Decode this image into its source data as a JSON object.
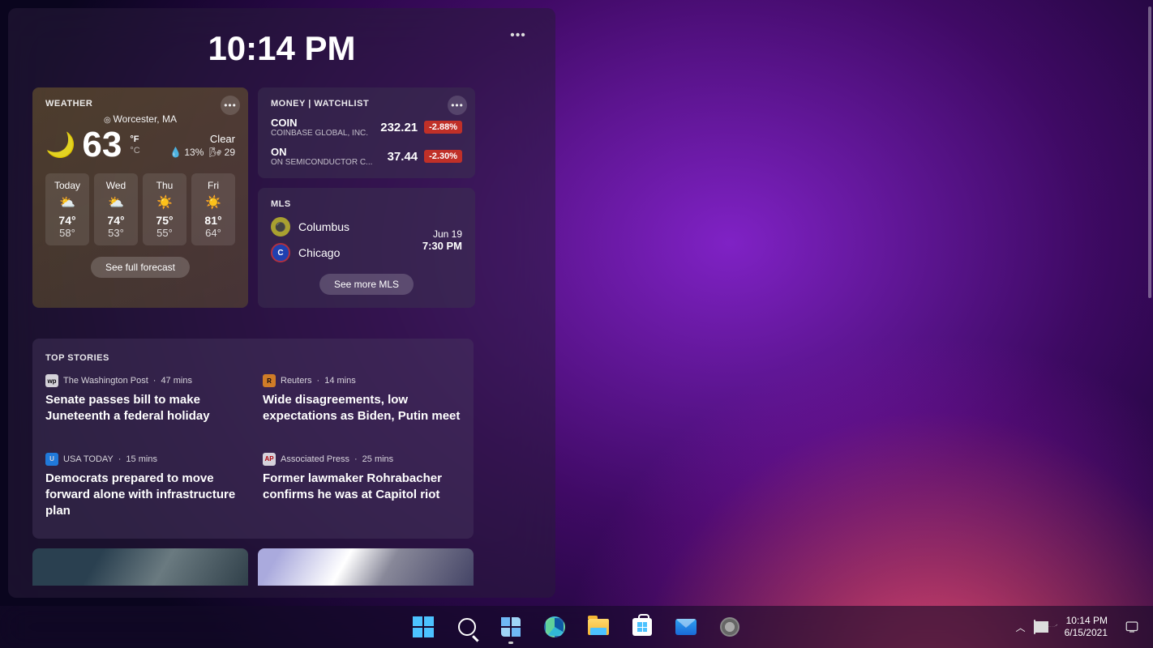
{
  "flyout": {
    "clock": "10:14 PM",
    "menu_icon": "•••"
  },
  "weather": {
    "title": "WEATHER",
    "location": "Worcester, MA",
    "icon": "🌙",
    "temp": "63",
    "unit_f": "°F",
    "unit_c": "°C",
    "condition": "Clear",
    "humidity": "💧 13%",
    "wind": "🌬 29",
    "forecast": [
      {
        "day": "Today",
        "icon": "⛅",
        "hi": "74°",
        "lo": "58°"
      },
      {
        "day": "Wed",
        "icon": "⛅",
        "hi": "74°",
        "lo": "53°"
      },
      {
        "day": "Thu",
        "icon": "☀️",
        "hi": "75°",
        "lo": "55°"
      },
      {
        "day": "Fri",
        "icon": "☀️",
        "hi": "81°",
        "lo": "64°"
      }
    ],
    "see_full": "See full forecast"
  },
  "money": {
    "title": "MONEY | WATCHLIST",
    "stocks": [
      {
        "symbol": "COIN",
        "company": "COINBASE GLOBAL, INC.",
        "price": "232.21",
        "change": "-2.88%"
      },
      {
        "symbol": "ON",
        "company": "ON SEMICONDUCTOR C...",
        "price": "37.44",
        "change": "-2.30%"
      }
    ]
  },
  "mls": {
    "title": "MLS",
    "team1": "Columbus",
    "team2": "Chicago",
    "date": "Jun 19",
    "time": "7:30 PM",
    "see_more": "See more MLS"
  },
  "topstories": {
    "title": "TOP STORIES",
    "stories": [
      {
        "src": "The Washington Post",
        "time": "47 mins",
        "hl": "Senate passes bill to make Juneteenth a federal holiday"
      },
      {
        "src": "Reuters",
        "time": "14 mins",
        "hl": "Wide disagreements, low expectations as Biden, Putin meet"
      },
      {
        "src": "USA TODAY",
        "time": "15 mins",
        "hl": "Democrats prepared to move forward alone with infrastructure plan"
      },
      {
        "src": "Associated Press",
        "time": "25 mins",
        "hl": "Former lawmaker Rohrabacher confirms he was at Capitol riot"
      }
    ]
  },
  "taskbar": {
    "time": "10:14 PM",
    "date": "6/15/2021"
  }
}
